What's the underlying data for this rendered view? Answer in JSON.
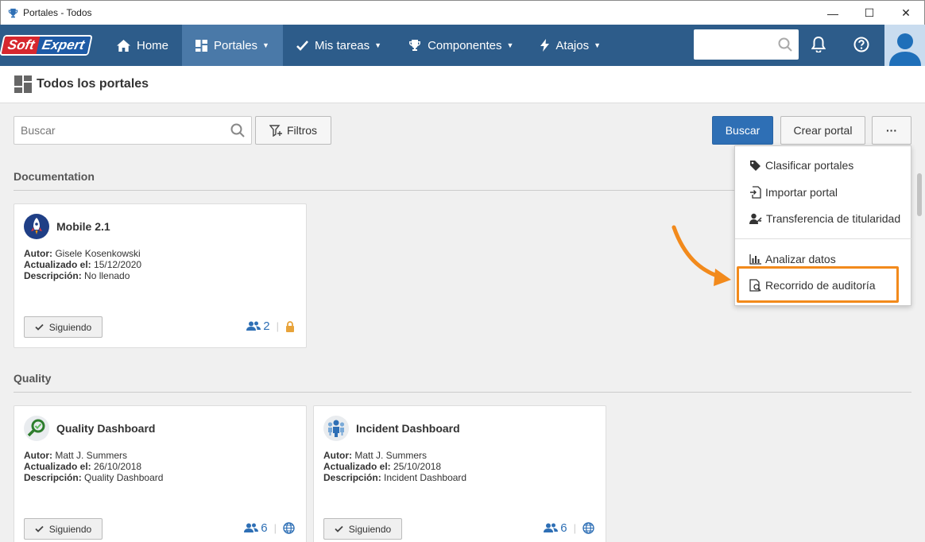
{
  "window": {
    "title": "Portales - Todos",
    "controls": {
      "minimize": "—",
      "maximize": "☐",
      "close": "✕"
    }
  },
  "brand": {
    "soft": "Soft",
    "expert": "Expert"
  },
  "navbar": {
    "items": [
      {
        "label": "Home",
        "icon": "home-icon"
      },
      {
        "label": "Portales",
        "icon": "portals-icon",
        "active": true
      },
      {
        "label": "Mis tareas",
        "icon": "check-icon"
      },
      {
        "label": "Componentes",
        "icon": "trophy-icon"
      },
      {
        "label": "Atajos",
        "icon": "bolt-icon"
      }
    ],
    "search_placeholder": "",
    "colors": {
      "bar": "#2d5c8a",
      "active": "#4a79a8"
    }
  },
  "page": {
    "title": "Todos los portales"
  },
  "toolbar": {
    "search_placeholder": "Buscar",
    "filters_label": "Filtros",
    "search_button": "Buscar",
    "create_button": "Crear portal",
    "more_button": "···"
  },
  "sections": [
    {
      "title": "Documentation",
      "cards": [
        {
          "title": "Mobile 2.1",
          "author_label": "Autor:",
          "author": "Gisele Kosenkowski",
          "updated_label": "Actualizado el:",
          "updated": "15/12/2020",
          "desc_label": "Descripción:",
          "desc": "No llenado",
          "follow_label": "Siguiendo",
          "members": "2",
          "visibility_icon": "lock-icon"
        }
      ]
    },
    {
      "title": "Quality",
      "cards": [
        {
          "title": "Quality Dashboard",
          "author_label": "Autor:",
          "author": "Matt J. Summers",
          "updated_label": "Actualizado el:",
          "updated": "26/10/2018",
          "desc_label": "Descripción:",
          "desc": "Quality Dashboard",
          "follow_label": "Siguiendo",
          "members": "6",
          "visibility_icon": "globe-icon"
        },
        {
          "title": "Incident Dashboard",
          "author_label": "Autor:",
          "author": "Matt J. Summers",
          "updated_label": "Actualizado el:",
          "updated": "25/10/2018",
          "desc_label": "Descripción:",
          "desc": "Incident Dashboard",
          "follow_label": "Siguiendo",
          "members": "6",
          "visibility_icon": "globe-icon"
        }
      ]
    }
  ],
  "dropdown": {
    "items": [
      {
        "label": "Clasificar portales",
        "icon": "tag-icon"
      },
      {
        "label": "Importar portal",
        "icon": "import-icon"
      },
      {
        "label": "Transferencia de titularidad",
        "icon": "user-transfer-icon"
      },
      {
        "label": "Analizar datos",
        "icon": "bar-chart-icon"
      },
      {
        "label": "Recorrido de auditoría",
        "icon": "audit-icon",
        "highlighted": true
      }
    ],
    "highlight_color": "#f28a1c"
  }
}
